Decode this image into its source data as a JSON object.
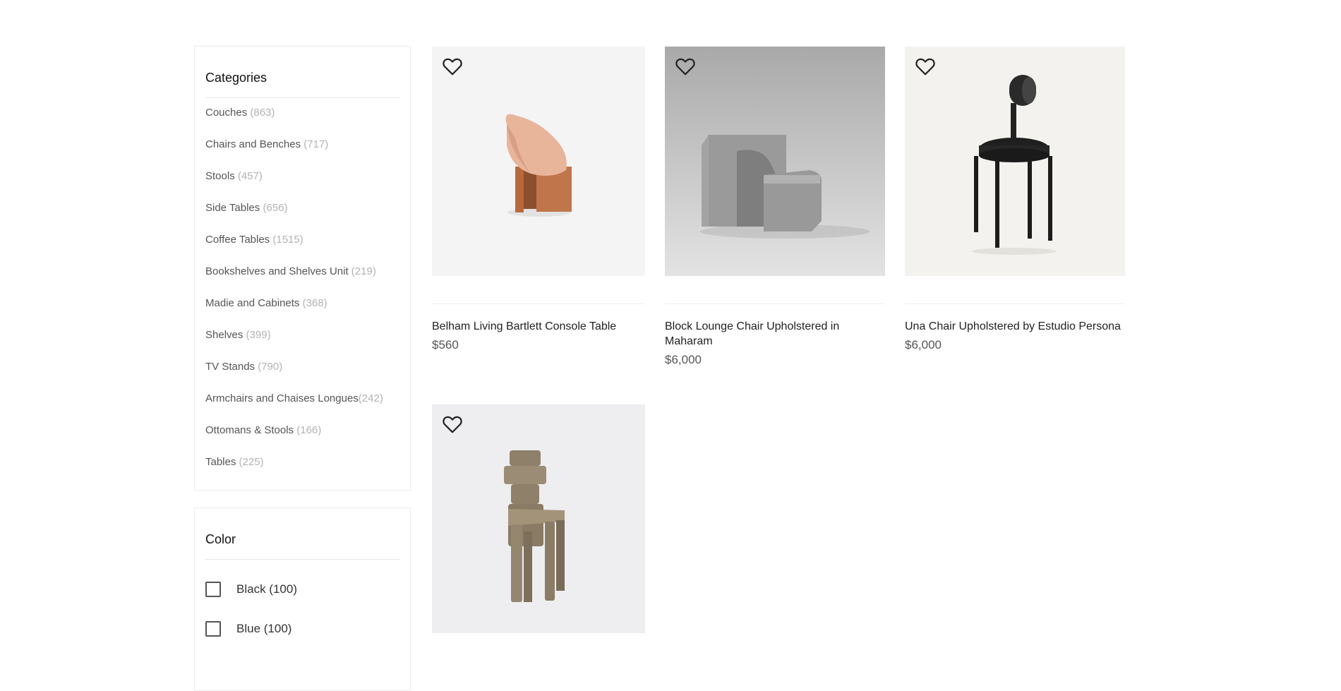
{
  "categories": {
    "title": "Categories",
    "items": [
      {
        "label": "Couches",
        "count": "(863)"
      },
      {
        "label": "Chairs and Benches",
        "count": "(717)"
      },
      {
        "label": "Stools",
        "count": "(457)"
      },
      {
        "label": "Side Tables",
        "count": "(656)"
      },
      {
        "label": "Coffee Tables",
        "count": "(1515)"
      },
      {
        "label": "Bookshelves and Shelves Unit",
        "count": "(219)"
      },
      {
        "label": "Madie and Cabinets",
        "count": "(368)"
      },
      {
        "label": "Shelves",
        "count": "(399)"
      },
      {
        "label": "TV Stands",
        "count": "(790)"
      },
      {
        "label": "Armchairs and Chaises Longues",
        "count": "(242)"
      },
      {
        "label": "Ottomans & Stools",
        "count": "(166)"
      },
      {
        "label": "Tables",
        "count": "(225)"
      }
    ]
  },
  "color_filter": {
    "title": "Color",
    "options": [
      {
        "label": "Black (100)",
        "checked": false
      },
      {
        "label": "Blue (100)",
        "checked": false
      }
    ]
  },
  "products": [
    {
      "name": "Belham Living Bartlett Console Table",
      "price": "$560",
      "image": "pink-wood-lounge-chair",
      "favorite_icon": "heart-outline-icon"
    },
    {
      "name": "Block Lounge Chair Upholstered in Maharam",
      "price": "$6,000",
      "image": "grey-block-lounge-chair",
      "favorite_icon": "heart-outline-icon"
    },
    {
      "name": "Una Chair Upholstered by Estudio Persona",
      "price": "$6,000",
      "image": "black-round-back-chair",
      "favorite_icon": "heart-outline-icon"
    },
    {
      "name": "",
      "price": "",
      "image": "taupe-velvet-tall-chair",
      "favorite_icon": "heart-outline-icon"
    }
  ]
}
